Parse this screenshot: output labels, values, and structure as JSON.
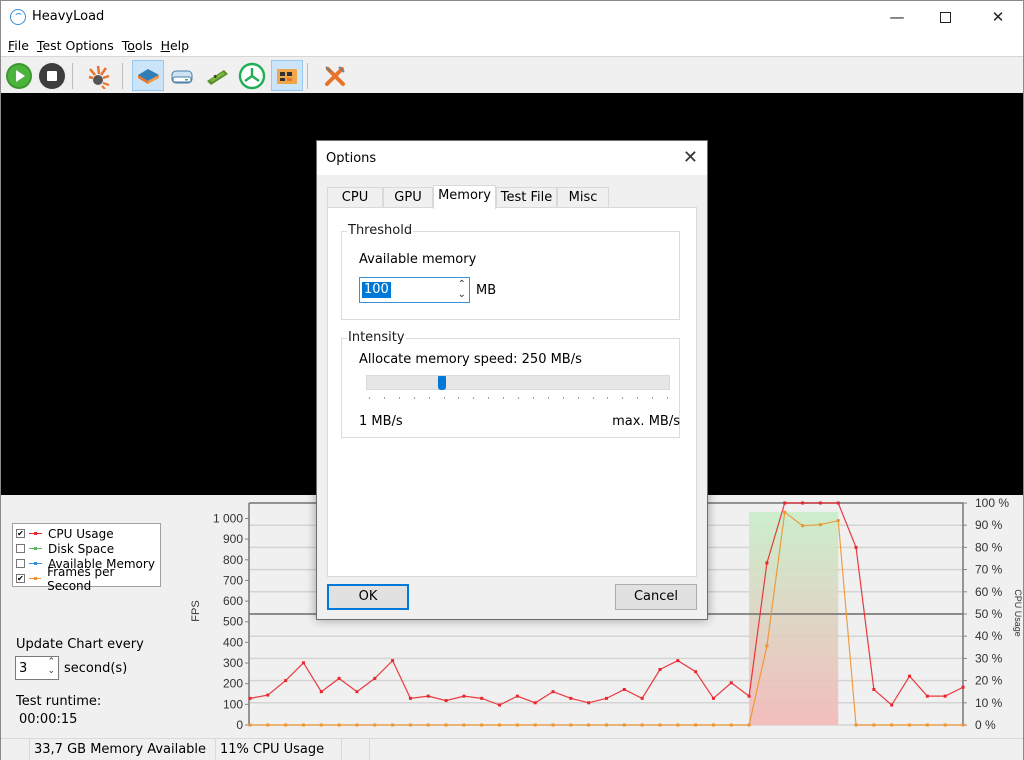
{
  "window": {
    "title": "HeavyLoad",
    "minimize_icon": "minimize-icon",
    "maximize_icon": "maximize-icon",
    "close_icon": "close-icon"
  },
  "menu": [
    {
      "label": "File",
      "access": "F"
    },
    {
      "label": "Test Options",
      "access": "T"
    },
    {
      "label": "Tools",
      "access": "o"
    },
    {
      "label": "Help",
      "access": "H"
    }
  ],
  "toolbar": {
    "buttons": [
      {
        "name": "start",
        "icon": "play-icon",
        "active": false
      },
      {
        "name": "stop",
        "icon": "stop-icon",
        "active": false
      },
      {
        "name": "stress-all",
        "icon": "explosion-icon",
        "active": false
      },
      {
        "name": "cpu-test",
        "icon": "cpu-chip-icon",
        "active": true
      },
      {
        "name": "disk-test",
        "icon": "hard-disk-icon",
        "active": false
      },
      {
        "name": "memory-test",
        "icon": "ram-stick-icon",
        "active": false
      },
      {
        "name": "treesize",
        "icon": "treesize-icon",
        "active": false
      },
      {
        "name": "gpu-test",
        "icon": "gpu-card-icon",
        "active": true
      },
      {
        "name": "options",
        "icon": "tools-icon",
        "active": false
      }
    ]
  },
  "legend": {
    "items": [
      {
        "label": "CPU Usage",
        "checked": true,
        "color": "#e8262c"
      },
      {
        "label": "Disk Space",
        "checked": false,
        "color": "#5cb85c"
      },
      {
        "label": "Available Memory",
        "checked": false,
        "color": "#3a8fd6"
      },
      {
        "label": "Frames per Second",
        "checked": true,
        "color": "#f0932b"
      }
    ]
  },
  "update": {
    "label": "Update Chart every",
    "value": "3",
    "unit": "second(s)"
  },
  "runtime": {
    "label": "Test runtime:",
    "value": "00:00:15"
  },
  "status": {
    "memory": "33,7 GB Memory Available",
    "cpu": "11% CPU Usage"
  },
  "chart_data": {
    "type": "line",
    "title": "",
    "left_axis": {
      "label": "FPS",
      "range": [
        0,
        1075
      ],
      "ticks": [
        "0",
        "100",
        "200",
        "300",
        "400",
        "500",
        "600",
        "700",
        "800",
        "900",
        "1 000"
      ]
    },
    "right_axis": {
      "label": "CPU Usage",
      "range": [
        0,
        100
      ],
      "ticks": [
        "0 %",
        "10 %",
        "20 %",
        "30 %",
        "40 %",
        "50 %",
        "60 %",
        "70 %",
        "80 %",
        "90 %",
        "100 %"
      ]
    },
    "grid": true,
    "threshold_line": 50,
    "highlight_range": {
      "from_index": 28,
      "to_index": 33,
      "top_percent": 96
    },
    "series": [
      {
        "name": "CPU Usage",
        "axis": "right",
        "color": "#e8262c",
        "values": [
          12,
          13.5,
          20,
          28,
          15,
          21,
          15,
          21,
          29,
          12,
          13,
          11,
          13,
          12,
          9,
          13,
          10,
          15,
          12,
          10,
          12,
          16,
          12,
          25,
          29,
          24,
          12,
          19,
          13,
          73,
          100,
          100,
          100,
          100,
          80,
          16,
          9,
          22,
          13,
          13,
          17
        ]
      },
      {
        "name": "Frames per Second",
        "axis": "left",
        "color": "#f0932b",
        "values": [
          0,
          0,
          0,
          0,
          0,
          0,
          0,
          0,
          0,
          0,
          0,
          0,
          0,
          0,
          0,
          0,
          0,
          0,
          0,
          0,
          0,
          0,
          0,
          0,
          0,
          0,
          0,
          0,
          0,
          383,
          1030,
          965,
          970,
          990,
          0,
          0,
          0,
          0,
          0,
          0,
          0
        ]
      }
    ]
  },
  "dialog": {
    "title": "Options",
    "tabs": [
      {
        "label": "CPU",
        "active": false
      },
      {
        "label": "GPU",
        "active": false
      },
      {
        "label": "Memory",
        "active": true
      },
      {
        "label": "Test File",
        "active": false
      },
      {
        "label": "Misc",
        "active": false
      }
    ],
    "threshold": {
      "group_label": "Threshold",
      "field_label": "Available memory",
      "value": "100",
      "unit": "MB"
    },
    "intensity": {
      "group_label": "Intensity",
      "speed_label": "Allocate memory speed: 250 MB/s",
      "slider_fraction": 0.25,
      "min_label": "1 MB/s",
      "max_label": "max. MB/s"
    },
    "ok_label": "OK",
    "cancel_label": "Cancel"
  }
}
